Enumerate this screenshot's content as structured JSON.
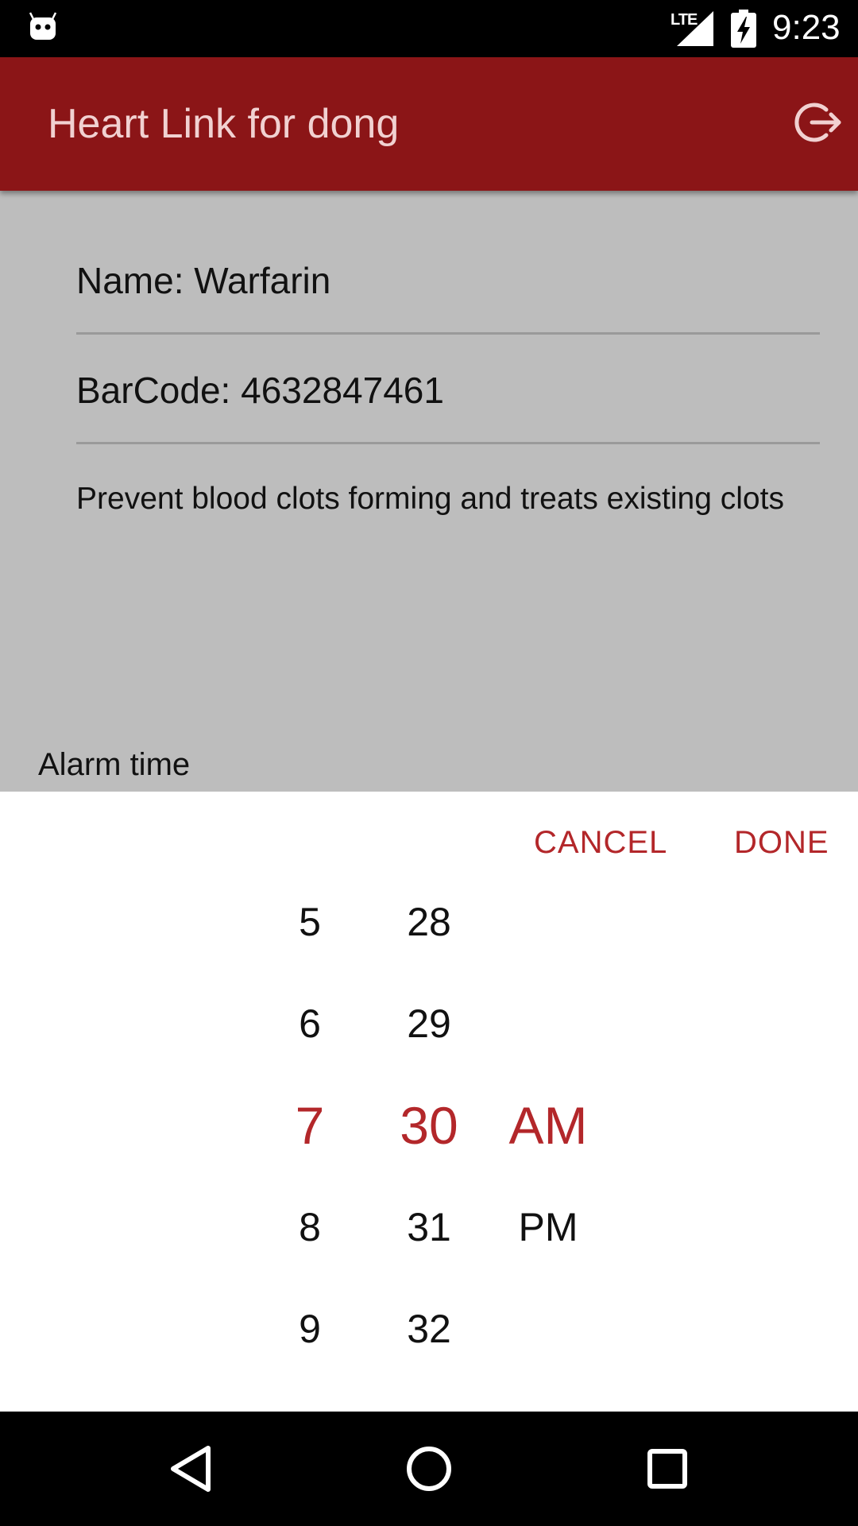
{
  "status_bar": {
    "network": "LTE",
    "time": "9:23",
    "icons": [
      "android-icon",
      "lte-signal-icon",
      "battery-charging-icon"
    ]
  },
  "app_bar": {
    "title": "Heart Link for dong",
    "logout_icon": "logout-icon"
  },
  "medication": {
    "name": "Name: Warfarin",
    "barcode": "BarCode: 4632847461",
    "description": "Prevent blood clots forming and treats existing clots"
  },
  "alarm": {
    "label": "Alarm time"
  },
  "time_picker": {
    "cancel_label": "CANCEL",
    "done_label": "DONE",
    "hours": [
      "5",
      "6",
      "7",
      "8",
      "9"
    ],
    "minutes": [
      "28",
      "29",
      "30",
      "31",
      "32"
    ],
    "ampm": [
      "AM",
      "PM"
    ],
    "selected": {
      "hour": "7",
      "minute": "30",
      "ampm": "AM"
    }
  },
  "nav_bar": {
    "icons": [
      "back-icon",
      "home-icon",
      "recents-icon"
    ]
  },
  "colors": {
    "primary": "#8b1517",
    "accent": "#b3272a",
    "dim_background": "#bdbdbd"
  }
}
